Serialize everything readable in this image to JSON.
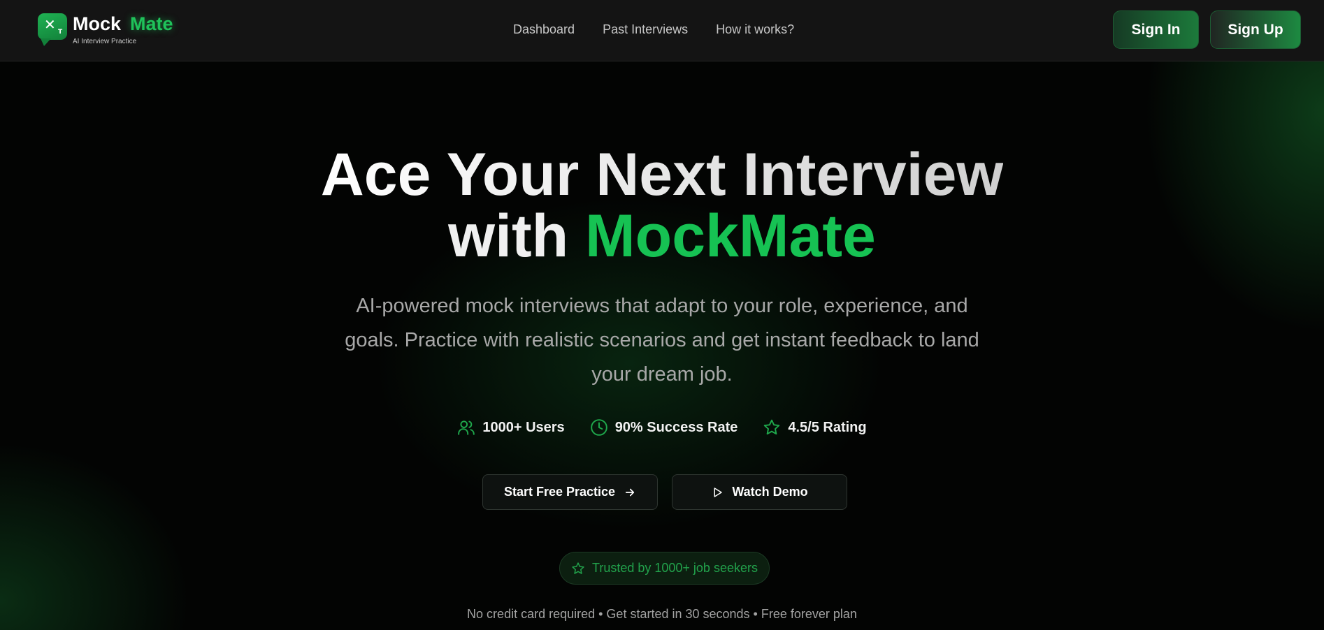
{
  "brand": {
    "name_part1": "Mock",
    "name_part2": "Mate",
    "tagline": "AI Interview Practice",
    "accent_color": "#16c253"
  },
  "nav": {
    "links": [
      "Dashboard",
      "Past Interviews",
      "How it works?"
    ],
    "sign_in": "Sign In",
    "sign_up": "Sign Up"
  },
  "hero": {
    "title_line1": "Ace Your Next Interview",
    "title_with": "with",
    "title_brand": "MockMate",
    "subtitle": "AI-powered mock interviews that adapt to your role, experience, and goals. Practice with realistic scenarios and get instant feedback to land your dream job."
  },
  "stats": [
    {
      "icon": "users-icon",
      "label": "1000+ Users"
    },
    {
      "icon": "clock-icon",
      "label": "90% Success Rate"
    },
    {
      "icon": "star-icon",
      "label": "4.5/5 Rating"
    }
  ],
  "cta": {
    "primary_label": "Start Free Practice",
    "secondary_label": "Watch Demo"
  },
  "trust_badge": "Trusted by 1000+ job seekers",
  "fineprint": "No credit card required • Get started in 30 seconds • Free forever plan"
}
